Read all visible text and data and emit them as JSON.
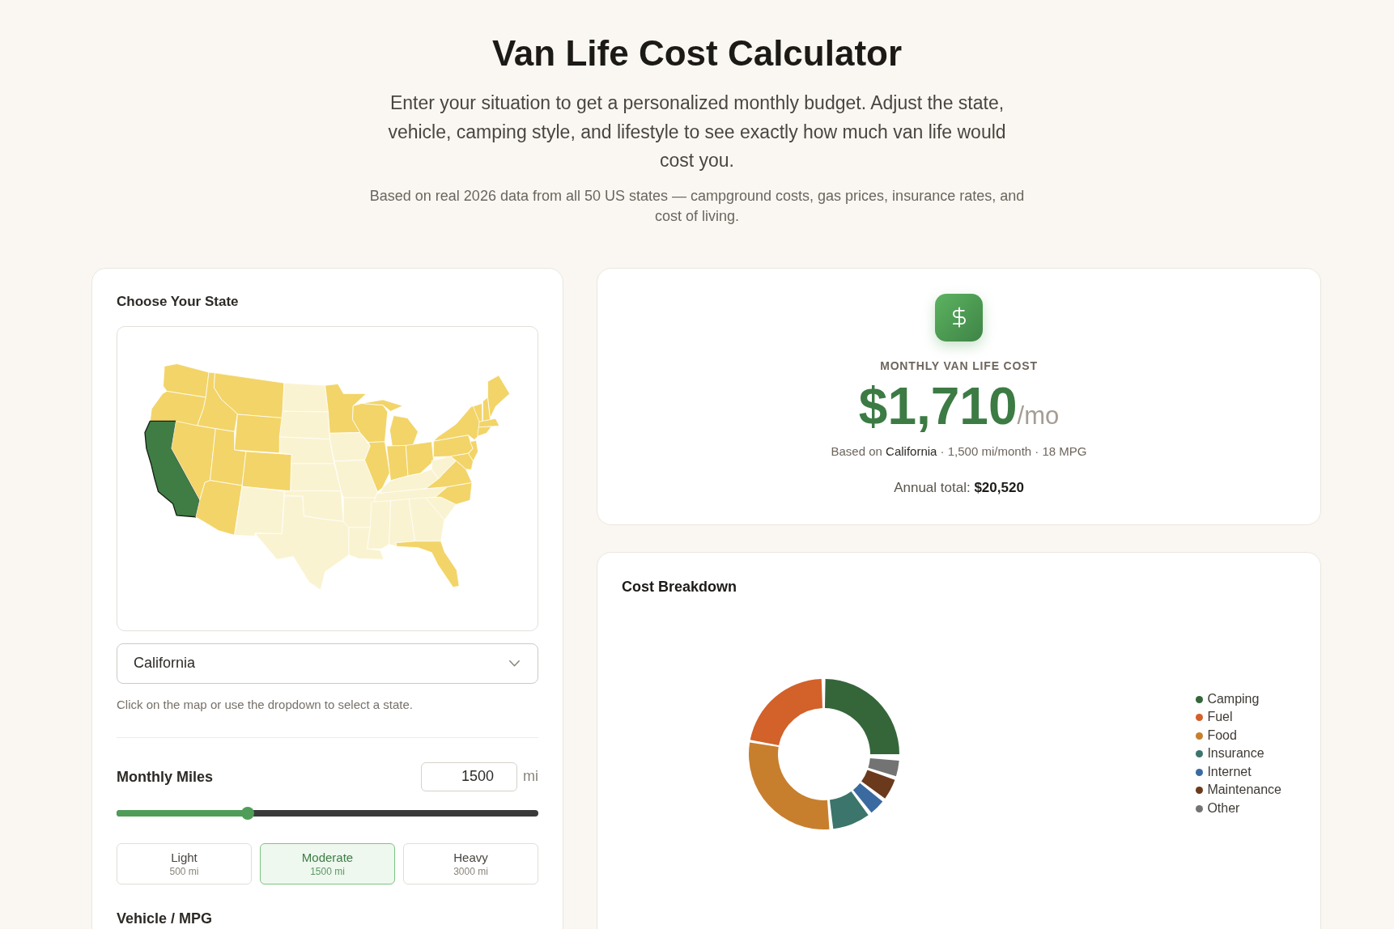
{
  "header": {
    "title": "Van Life Cost Calculator",
    "intro": "Enter your situation to get a personalized monthly budget. Adjust the state, vehicle, camping style, and lifestyle to see exactly how much van life would cost you.",
    "note": "Based on real 2026 data from all 50 US states — campground costs, gas prices, insurance rates, and cost of living."
  },
  "state_panel": {
    "title": "Choose Your State",
    "map": {
      "regions": [
        {
          "color": "#f2d468",
          "selected": false
        },
        {
          "color": "#f2d468",
          "selected": false
        },
        {
          "color": "#3f7d45",
          "selected": true
        },
        {
          "color": "#f2d468",
          "selected": false
        },
        {
          "color": "#f2d468",
          "selected": false
        },
        {
          "color": "#f2d468",
          "selected": false
        },
        {
          "color": "#f2d468",
          "selected": false
        },
        {
          "color": "#f2d468",
          "selected": false
        },
        {
          "color": "#f2d468",
          "selected": false
        },
        {
          "color": "#f2d468",
          "selected": false
        },
        {
          "color": "#faf3d1",
          "selected": false
        },
        {
          "color": "#faf3d1",
          "selected": false
        },
        {
          "color": "#faf3d1",
          "selected": false
        },
        {
          "color": "#faf3d1",
          "selected": false
        },
        {
          "color": "#faf3d1",
          "selected": false
        },
        {
          "color": "#faf3d1",
          "selected": false
        },
        {
          "color": "#faf3d1",
          "selected": false
        },
        {
          "color": "#f2d468",
          "selected": false
        },
        {
          "color": "#faf3d1",
          "selected": false
        },
        {
          "color": "#faf3d1",
          "selected": false
        },
        {
          "color": "#faf3d1",
          "selected": false
        },
        {
          "color": "#faf3d1",
          "selected": false
        },
        {
          "color": "#f2d468",
          "selected": false
        },
        {
          "color": "#f2d468",
          "selected": false
        },
        {
          "color": "#f2d468",
          "selected": false
        },
        {
          "color": "#f2d468",
          "selected": false
        },
        {
          "color": "#f2d468",
          "selected": false
        },
        {
          "color": "#faf3d1",
          "selected": false
        },
        {
          "color": "#faf3d1",
          "selected": false
        },
        {
          "color": "#faf3d1",
          "selected": false
        },
        {
          "color": "#faf3d1",
          "selected": false
        },
        {
          "color": "#faf3d1",
          "selected": false
        },
        {
          "color": "#f2d468",
          "selected": false
        },
        {
          "color": "#faf3d1",
          "selected": false
        },
        {
          "color": "#f2d468",
          "selected": false
        },
        {
          "color": "#f2d468",
          "selected": false
        },
        {
          "color": "#faf3d1",
          "selected": false
        },
        {
          "color": "#f2d468",
          "selected": false
        },
        {
          "color": "#f2d468",
          "selected": false
        },
        {
          "color": "#f2d468",
          "selected": false
        },
        {
          "color": "#f2d468",
          "selected": false
        },
        {
          "color": "#f2d468",
          "selected": false
        },
        {
          "color": "#f2d468",
          "selected": false
        },
        {
          "color": "#f2d468",
          "selected": false
        },
        {
          "color": "#f2d468",
          "selected": false
        },
        {
          "color": "#f2d468",
          "selected": false
        }
      ]
    },
    "state_select": {
      "value": "California"
    },
    "help_text": "Click on the map or use the dropdown to select a state."
  },
  "miles": {
    "label": "Monthly Miles",
    "input_value": "1500",
    "unit": "mi",
    "slider": {
      "level": 0.31
    },
    "presets": [
      {
        "label": "Light",
        "detail": "500 mi",
        "selected": false
      },
      {
        "label": "Moderate",
        "detail": "1500 mi",
        "selected": true
      },
      {
        "label": "Heavy",
        "detail": "3000 mi",
        "selected": false
      }
    ]
  },
  "vehicle": {
    "label": "Vehicle / MPG"
  },
  "result": {
    "label": "MONTHLY VAN LIFE COST",
    "amount": "$1,710",
    "per": "/mo",
    "summary": {
      "prefix": "Based on",
      "state": "California",
      "rest": "· 1,500 mi/month · 18 MPG"
    },
    "annual": "Annual total: **$20,520**"
  },
  "breakdown": {
    "title": "Cost Breakdown",
    "legend": [
      {
        "label": "Camping",
        "color": "#35663a"
      },
      {
        "label": "Fuel",
        "color": "#d2612a"
      },
      {
        "label": "Food",
        "color": "#c77f2e"
      },
      {
        "label": "Insurance",
        "color": "#3b756b"
      },
      {
        "label": "Internet",
        "color": "#3b6aa0"
      },
      {
        "label": "Maintenance",
        "color": "#6b3a1c"
      },
      {
        "label": "Other",
        "color": "#737373"
      }
    ]
  }
}
